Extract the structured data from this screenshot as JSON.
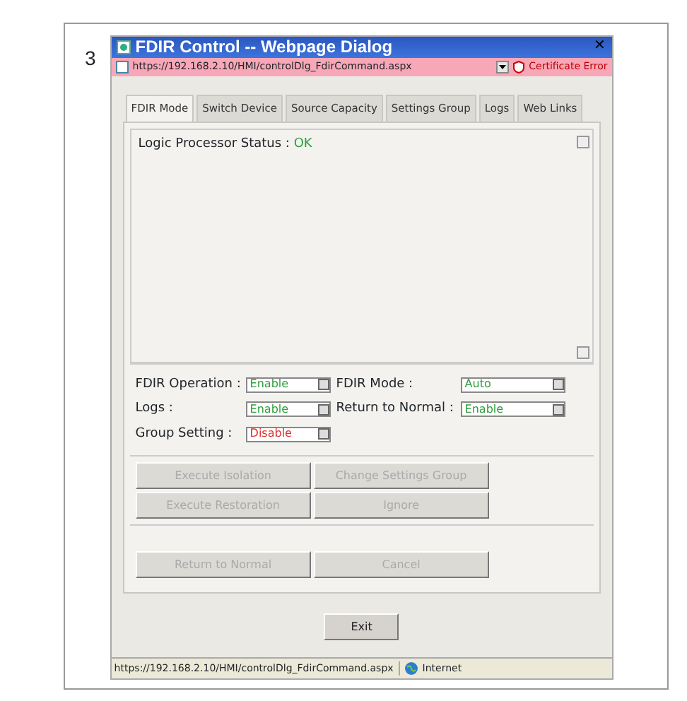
{
  "figure_number": "3",
  "window": {
    "title": "FDIR Control -- Webpage Dialog",
    "close_glyph": "✕",
    "address": "https://192.168.2.10/HMI/controlDlg_FdirCommand.aspx",
    "certificate": "Certificate Error"
  },
  "tabs": [
    {
      "label": "FDIR Mode",
      "selected": true
    },
    {
      "label": "Switch Device",
      "selected": false
    },
    {
      "label": "Source Capacity",
      "selected": false
    },
    {
      "label": "Settings Group",
      "selected": false
    },
    {
      "label": "Logs",
      "selected": false
    },
    {
      "label": "Web Links",
      "selected": false
    }
  ],
  "status_panel": {
    "label": "Logic Processor Status  :",
    "value": "OK",
    "color": "#2e9e3e"
  },
  "settings": [
    {
      "label": "FDIR Operation :",
      "value": "Enable",
      "color": "#2e9e3e"
    },
    {
      "label": "FDIR Mode :",
      "value": "Auto",
      "color": "#2e9e3e"
    },
    {
      "label": "Logs :",
      "value": "Enable",
      "color": "#2e9e3e"
    },
    {
      "label": "Return to Normal :",
      "value": "Enable",
      "color": "#2e9e3e"
    },
    {
      "label": "Group Setting :",
      "value": "Disable",
      "color": "#e03030"
    }
  ],
  "action_groups": [
    [
      {
        "label": "Execute Isolation",
        "disabled": true
      },
      {
        "label": "Change Settings Group",
        "disabled": true
      },
      {
        "label": "Execute Restoration",
        "disabled": true
      },
      {
        "label": "Ignore",
        "disabled": true
      }
    ],
    [
      {
        "label": "Return to Normal",
        "disabled": true
      },
      {
        "label": "Cancel",
        "disabled": true
      }
    ]
  ],
  "exit_button": {
    "label": "Exit",
    "disabled": false
  },
  "status_bar": {
    "url": "https://192.168.2.10/HMI/controlDlg_FdirCommand.aspx",
    "zone": "Internet"
  }
}
